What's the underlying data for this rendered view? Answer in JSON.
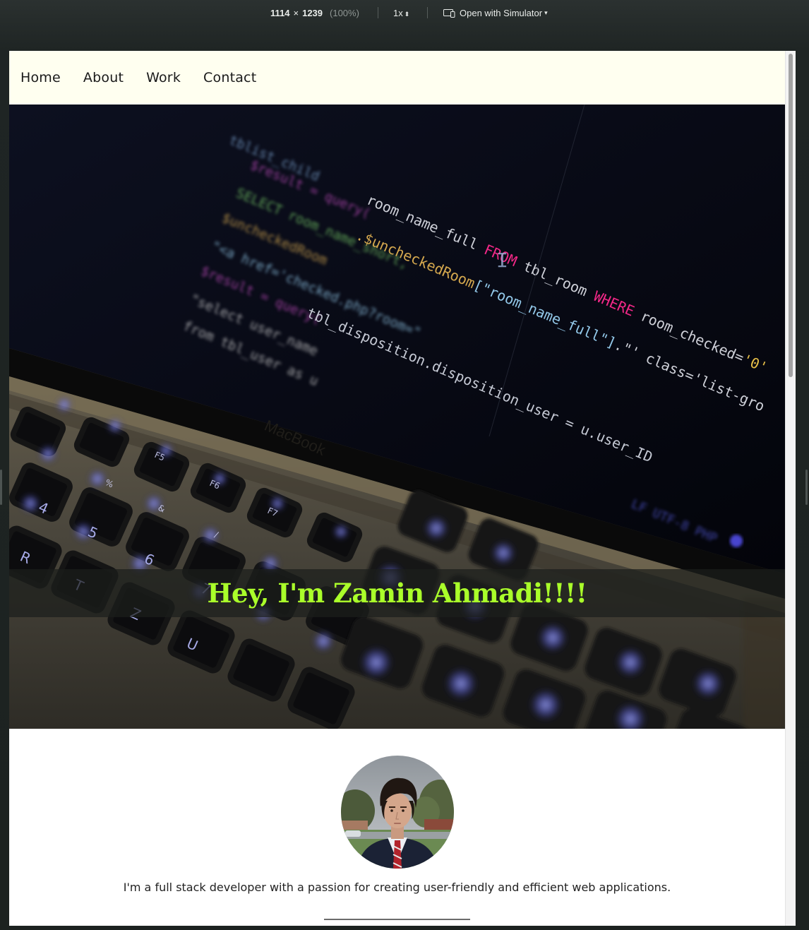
{
  "simulator": {
    "width": "1114",
    "times": "×",
    "height": "1239",
    "zoom": "(100%)",
    "scale": "1x",
    "open_label": "Open with Simulator"
  },
  "nav": {
    "items": [
      "Home",
      "About",
      "Work",
      "Contact"
    ]
  },
  "hero": {
    "title": "Hey, I'm Zamin Ahmadi!!!!",
    "title_color": "#aaff2a",
    "code_lines": [
      "room_name_full FROM tbl_room WHERE room_checked='0'",
      ".$uncheckedRoom[\"room_name_full\"].\"' class='list-gro",
      "tbl_disposition.disposition_user = u.user_ID"
    ],
    "laptop_brand": "MacBook",
    "screen_status": "LF   UTF-8   PHP"
  },
  "about": {
    "bio": "I'm a full stack developer with a passion for creating user-friendly and efficient web applications."
  },
  "colors": {
    "nav_bg": "#fffff0",
    "accent": "#aaff2a"
  }
}
